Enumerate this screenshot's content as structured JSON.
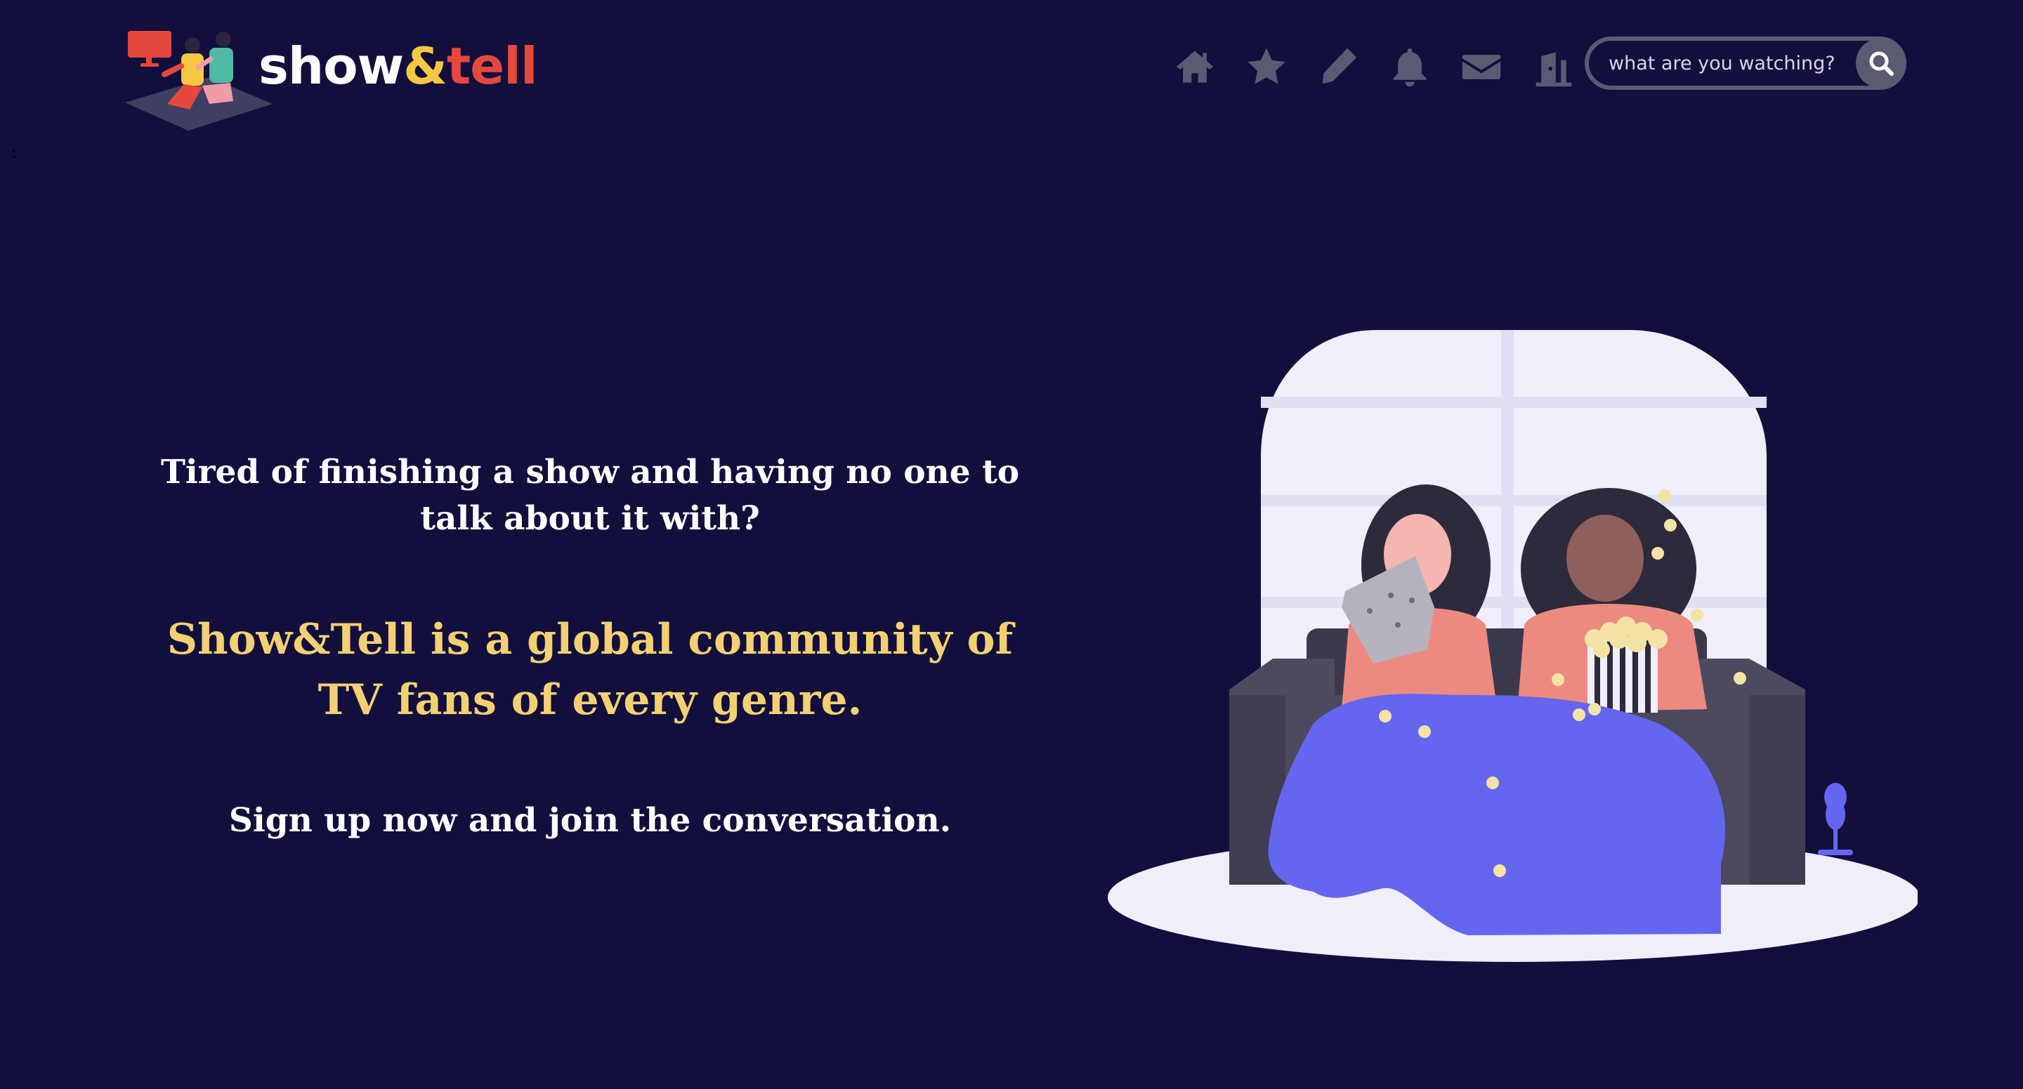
{
  "brand": {
    "name_show": "show",
    "name_amp": "&",
    "name_tell": "tell",
    "colors": {
      "background": "#130f3d",
      "show": "#ffffff",
      "amp": "#f5c842",
      "tell": "#e5483c",
      "tagline": "#f3d172",
      "icon": "#5a5a73"
    }
  },
  "nav": {
    "icons": [
      "home-icon",
      "star-icon",
      "pencil-icon",
      "bell-icon",
      "envelope-icon",
      "door-exit-icon"
    ]
  },
  "search": {
    "placeholder": "what are you watching?",
    "icon": "search-icon"
  },
  "stray_mark": ":",
  "hero": {
    "question_line1": "Tired of finishing a show and having no one to",
    "question_line2": "talk about it with?",
    "tagline_line1": "Show&Tell is a global community of",
    "tagline_line2": "TV fans of every genre.",
    "cta": "Sign up now and join the conversation."
  },
  "illustration": {
    "subject": "two-people-on-couch-watching-tv-with-popcorn"
  }
}
